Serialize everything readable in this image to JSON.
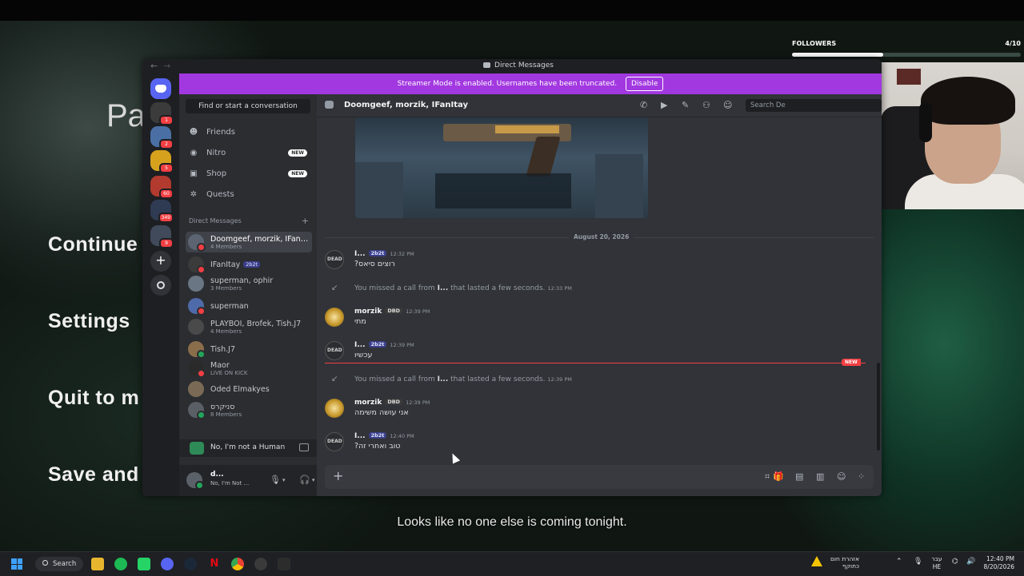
{
  "game": {
    "partial_title": "Pa",
    "menu": [
      "Continue",
      "Settings",
      "Quit to m",
      "Save and"
    ],
    "subtitle": "Looks like no one else is coming tonight."
  },
  "stream": {
    "followers_label": "FOLLOWERS",
    "followers_count": "4/10",
    "followers_progress": 0.4
  },
  "window": {
    "title": "Direct Messages",
    "back_icon": "arrow-left-icon",
    "forward_icon": "arrow-right-icon"
  },
  "banner": {
    "text": "Streamer Mode is enabled. Usernames have been truncated.",
    "button": "Disable",
    "color": "#a238e0"
  },
  "servers": [
    {
      "badge": ""
    },
    {
      "badge": "1"
    },
    {
      "badge": "2"
    },
    {
      "badge": "5"
    },
    {
      "badge": "60"
    },
    {
      "badge": "349"
    },
    {
      "badge": "9"
    }
  ],
  "sidebar": {
    "search_placeholder": "Find or start a conversation",
    "nav": [
      {
        "label": "Friends",
        "icon": "friends-icon",
        "badge": ""
      },
      {
        "label": "Nitro",
        "icon": "nitro-icon",
        "badge": "NEW"
      },
      {
        "label": "Shop",
        "icon": "shop-icon",
        "badge": "NEW"
      },
      {
        "label": "Quests",
        "icon": "quests-icon",
        "badge": ""
      }
    ],
    "dm_header": "Direct Messages",
    "dms": [
      {
        "name": "Doomgeef, morzik, IFanItay",
        "sub": "4 Members",
        "active": true
      },
      {
        "name": "IFanItay",
        "tag": "2b2t",
        "sub": ""
      },
      {
        "name": "superman, ophir",
        "sub": "3 Members"
      },
      {
        "name": "superman",
        "sub": ""
      },
      {
        "name": "PLAYBOI, Brofek, Tish.J7",
        "sub": "4 Members"
      },
      {
        "name": "Tish.J7",
        "sub": ""
      },
      {
        "name": "Maor",
        "sub": "LIVE ON KICK"
      },
      {
        "name": "Oded Elmakyes",
        "sub": ""
      },
      {
        "name": "סניקרס",
        "sub": "8 Members"
      }
    ]
  },
  "activity": {
    "text": "No, I'm not a Human"
  },
  "user": {
    "name": "d...",
    "status": "No, I'm Not ..."
  },
  "chat": {
    "title": "Doomgeef, morzik, IFanItay",
    "search_placeholder": "Search De",
    "date_separator": "August 20, 2026",
    "new_label": "NEW",
    "messages": [
      {
        "author": "I...",
        "tag": "2b2t",
        "time": "12:32 PM",
        "text": "רוצים סיאס?"
      },
      {
        "system": true,
        "pre": "You missed a call from ",
        "who": "I...",
        "post": " that lasted a few seconds.",
        "time": "12:33 PM"
      },
      {
        "author": "morzik",
        "tag": "DBD",
        "time": "12:39 PM",
        "text": "מתי"
      },
      {
        "author": "I...",
        "tag": "2b2t",
        "time": "12:39 PM",
        "text": "עכשיו"
      },
      {
        "system": true,
        "pre": "You missed a call from ",
        "who": "I...",
        "post": " that lasted a few seconds.",
        "time": "12:39 PM"
      },
      {
        "author": "morzik",
        "tag": "DBD",
        "time": "12:39 PM",
        "text": "אני עושה משימה"
      },
      {
        "author": "I...",
        "tag": "2b2t",
        "time": "12:40 PM",
        "text": "טוב ואחרי זה?"
      }
    ]
  },
  "taskbar": {
    "search": "Search",
    "warning": "אזהרת חום כתוקף",
    "lang_top": "עבר",
    "lang_bottom": "HE",
    "time": "12:40 PM",
    "date": "8/20/2026"
  }
}
